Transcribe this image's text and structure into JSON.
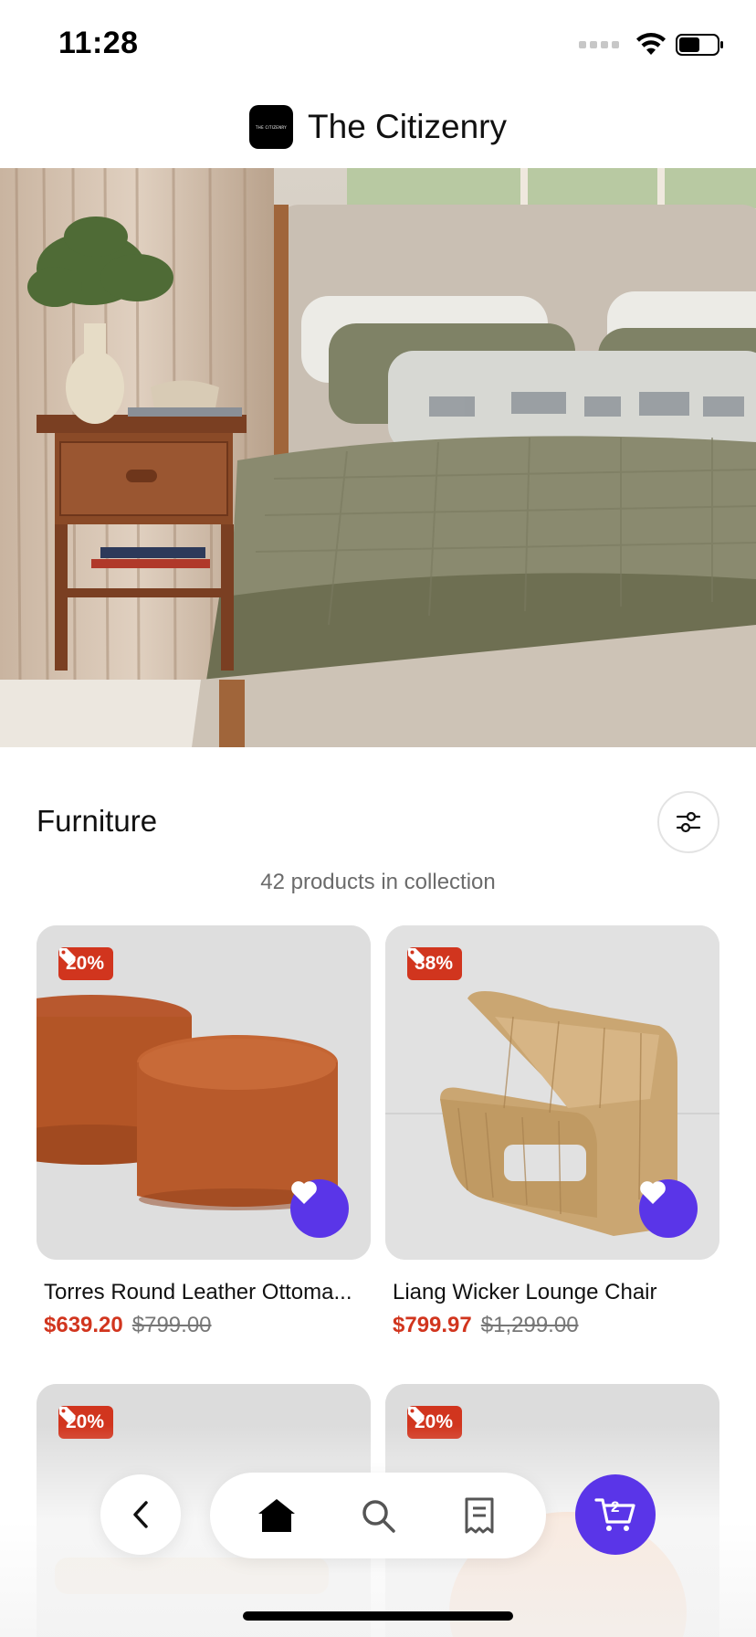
{
  "status": {
    "time": "11:28"
  },
  "header": {
    "brand_name": "The Citizenry",
    "logo_text": "THE CITIZENRY"
  },
  "collection": {
    "title": "Furniture",
    "count_text": "42 products in collection"
  },
  "products": [
    {
      "name": "Torres Round Leather Ottoma...",
      "discount": "20%",
      "sale_price": "$639.20",
      "original_price": "$799.00"
    },
    {
      "name": "Liang Wicker Lounge Chair",
      "discount": "38%",
      "sale_price": "$799.97",
      "original_price": "$1,299.00"
    },
    {
      "discount": "20%"
    },
    {
      "discount": "20%"
    }
  ],
  "cart": {
    "count": "2"
  },
  "icons": {
    "tag": "tag-icon",
    "heart": "heart-icon",
    "filter": "sliders-icon",
    "back": "chevron-left-icon",
    "home": "home-icon",
    "search": "search-icon",
    "orders": "receipt-icon",
    "cart": "cart-icon"
  },
  "colors": {
    "accent": "#5a35e8",
    "sale": "#d1351e"
  }
}
